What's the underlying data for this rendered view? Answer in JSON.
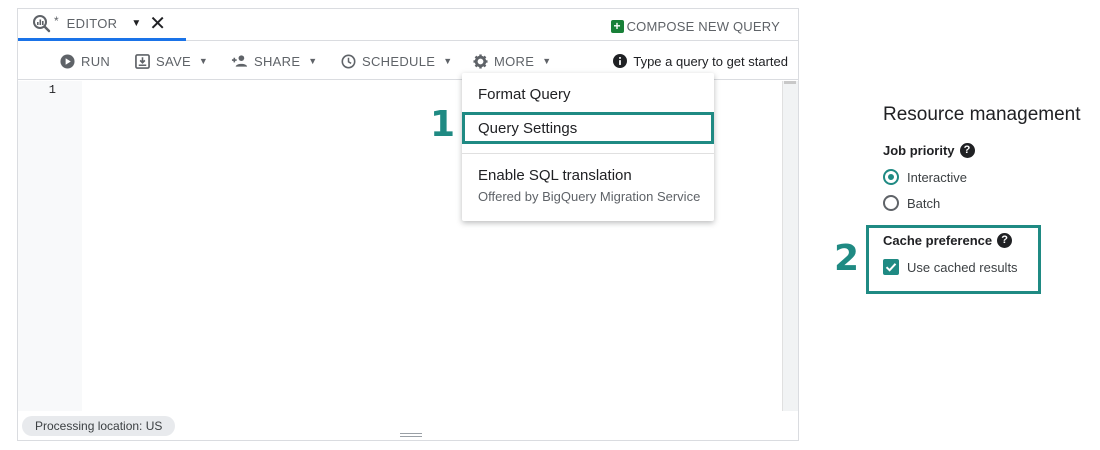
{
  "colors": {
    "accent": "#1f8a83",
    "tab_underline": "#1a73e8",
    "compose_green": "#188038"
  },
  "tab": {
    "star": "*",
    "label": "EDITOR",
    "icon": "query-icon"
  },
  "header": {
    "compose_label": "COMPOSE NEW QUERY"
  },
  "toolbar": {
    "run_label": "RUN",
    "save_label": "SAVE",
    "share_label": "SHARE",
    "schedule_label": "SCHEDULE",
    "more_label": "MORE",
    "hint_text": "Type a query to get started"
  },
  "editor": {
    "line_numbers": [
      "1"
    ],
    "processing_location": "Processing location: US"
  },
  "more_menu": {
    "items": [
      {
        "label": "Format Query"
      },
      {
        "label": "Query Settings"
      },
      {
        "label": "Enable SQL translation",
        "sublabel": "Offered by BigQuery Migration Service"
      }
    ]
  },
  "steps": {
    "first": "1",
    "second": "2"
  },
  "resource_management": {
    "title": "Resource management",
    "job_priority_label": "Job priority",
    "options": [
      {
        "label": "Interactive",
        "selected": true
      },
      {
        "label": "Batch",
        "selected": false
      }
    ],
    "cache_preference_label": "Cache preference",
    "cache_checkbox_label": "Use cached results",
    "cache_checked": true
  }
}
